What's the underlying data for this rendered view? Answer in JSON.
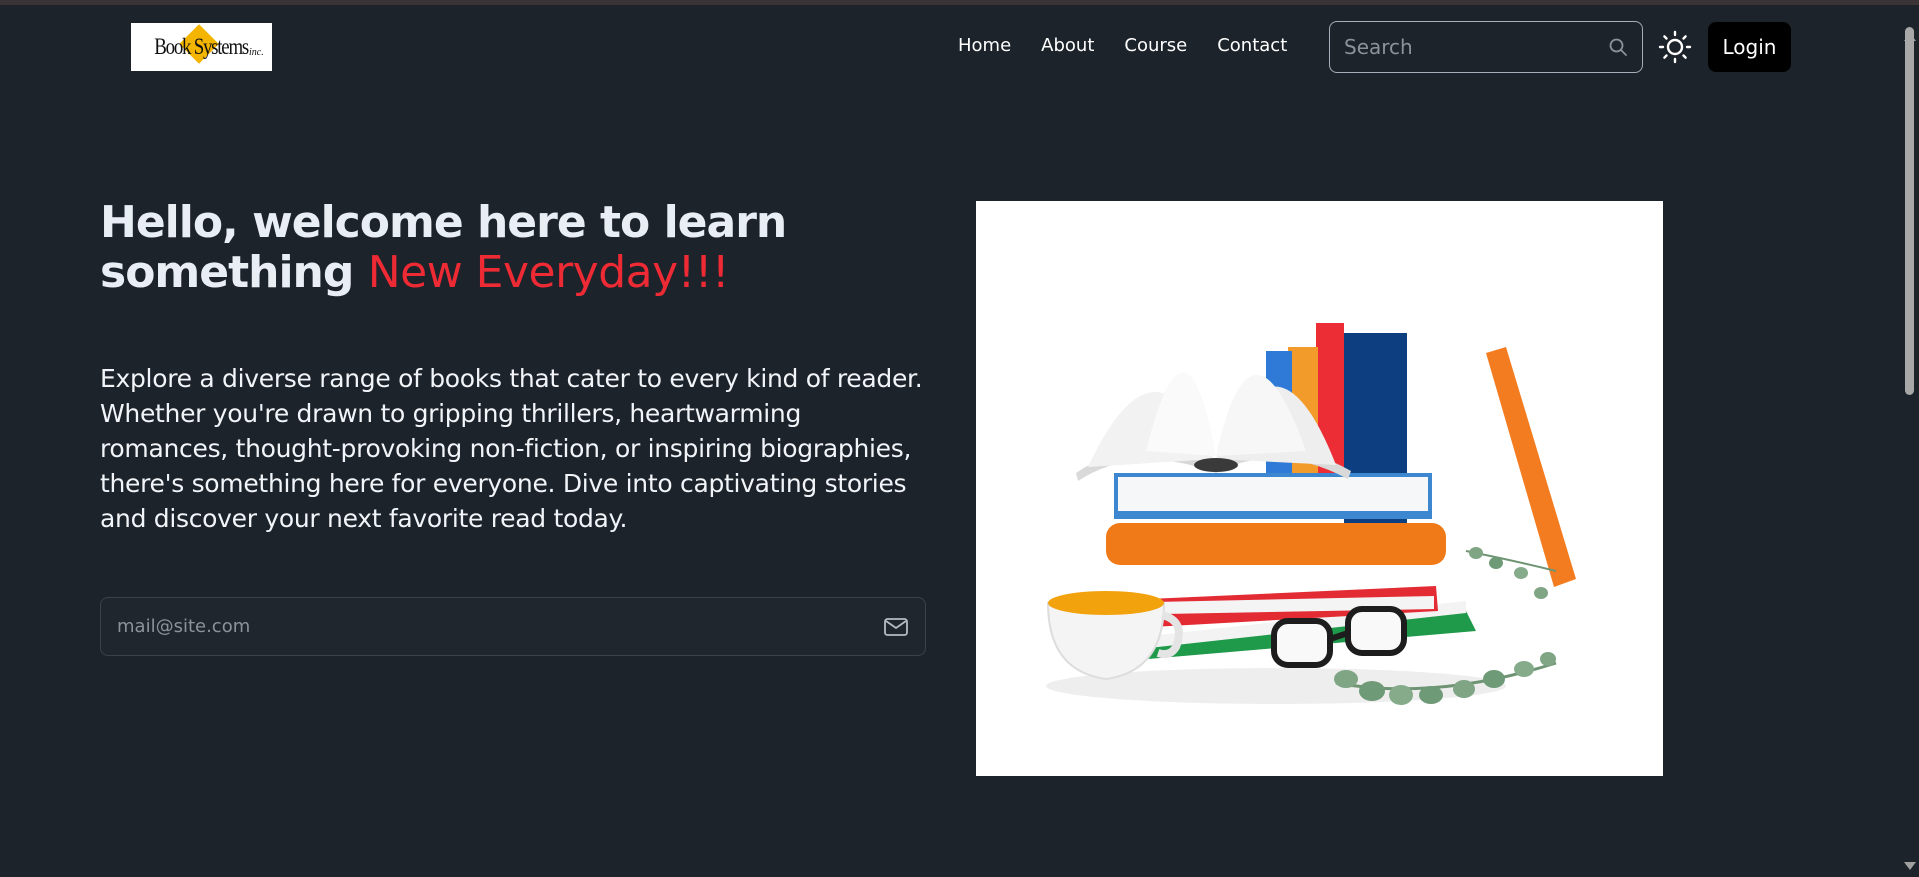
{
  "brand": {
    "name": "Book Systems",
    "suffix": "inc."
  },
  "nav": {
    "items": [
      {
        "label": "Home"
      },
      {
        "label": "About"
      },
      {
        "label": "Course"
      },
      {
        "label": "Contact"
      }
    ]
  },
  "search": {
    "placeholder": "Search",
    "icon": "search-icon"
  },
  "theme_toggle": {
    "icon": "sun-icon"
  },
  "login": {
    "label": "Login"
  },
  "hero": {
    "headline_line1": "Hello, welcome here to learn",
    "headline_line2_prefix": "something",
    "headline_accent": "New Everyday!!!",
    "description": "Explore a diverse range of books that cater to every kind of reader. Whether you're drawn to gripping thrillers, heartwarming romances, thought-provoking non-fiction, or inspiring biographies, there's something here for everyone. Dive into captivating stories and discover your next favorite read today.",
    "email_placeholder": "mail@site.com",
    "email_icon": "mail-icon",
    "image": "books-illustration"
  },
  "colors": {
    "background": "#1d232a",
    "accent": "#ee2a34",
    "login_bg": "#000000",
    "logo_diamond": "#f4b500"
  }
}
